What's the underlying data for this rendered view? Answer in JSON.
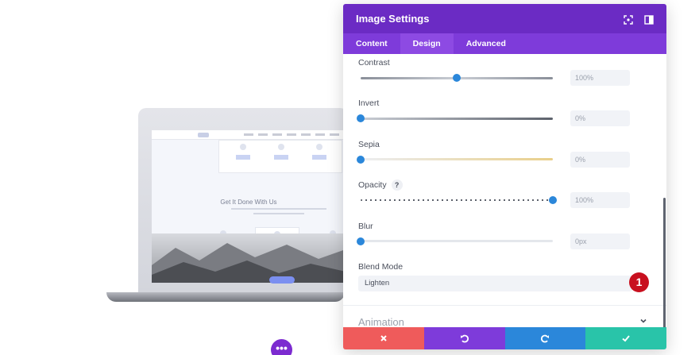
{
  "panel": {
    "title": "Image Settings",
    "header_icons": [
      "focus-icon",
      "sidebar-layout-icon"
    ],
    "tabs": [
      {
        "label": "Content",
        "active": false
      },
      {
        "label": "Design",
        "active": true
      },
      {
        "label": "Advanced",
        "active": false
      }
    ],
    "settings": {
      "contrast": {
        "label": "Contrast",
        "value": "100%",
        "level": 0.5
      },
      "invert": {
        "label": "Invert",
        "value": "0%",
        "level": 0
      },
      "sepia": {
        "label": "Sepia",
        "value": "0%",
        "level": 0
      },
      "opacity": {
        "label": "Opacity",
        "value": "100%",
        "level": 1,
        "help": "?"
      },
      "blur": {
        "label": "Blur",
        "value": "0px",
        "level": 0
      },
      "blend_mode": {
        "label": "Blend Mode",
        "value": "Lighten"
      }
    },
    "callout_badge": "1",
    "collapsed_section": "Animation",
    "footer": {
      "cancel": {
        "icon": "close-icon",
        "color": "#ef5b5b"
      },
      "undo": {
        "icon": "undo-icon",
        "color": "#7e3bda"
      },
      "redo": {
        "icon": "redo-icon",
        "color": "#2b87da"
      },
      "save": {
        "icon": "check-icon",
        "color": "#29c4a9"
      }
    }
  },
  "preview": {
    "screen_title": "Get It Done With Us",
    "more_button": "•••"
  },
  "colors": {
    "header": "#6b2bc4",
    "tabs": "#7e3bda",
    "accent": "#2b87da",
    "badge": "#c8101f"
  }
}
